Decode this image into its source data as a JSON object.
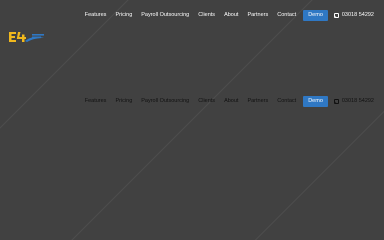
{
  "header": {
    "nav": [
      {
        "label": "Features"
      },
      {
        "label": "Pricing"
      },
      {
        "label": "Payroll Outsourcing"
      },
      {
        "label": "Clients"
      },
      {
        "label": "About"
      },
      {
        "label": "Partners"
      },
      {
        "label": "Contact"
      }
    ],
    "demo_label": "Demo",
    "phone": "03018 54292",
    "phone_icon": "phone-icon"
  },
  "sticky_nav": {
    "nav": [
      {
        "label": "Features"
      },
      {
        "label": "Pricing"
      },
      {
        "label": "Payroll Outsourcing"
      },
      {
        "label": "Clients"
      },
      {
        "label": "About"
      },
      {
        "label": "Partners"
      },
      {
        "label": "Contact"
      }
    ],
    "demo_label": "Demo",
    "phone": "03018 54292",
    "phone_icon": "phone-icon"
  },
  "colors": {
    "background": "#414141",
    "accent": "#2f78c4",
    "logo_yellow": "#f0b81d",
    "logo_blue": "#2f78c4"
  }
}
